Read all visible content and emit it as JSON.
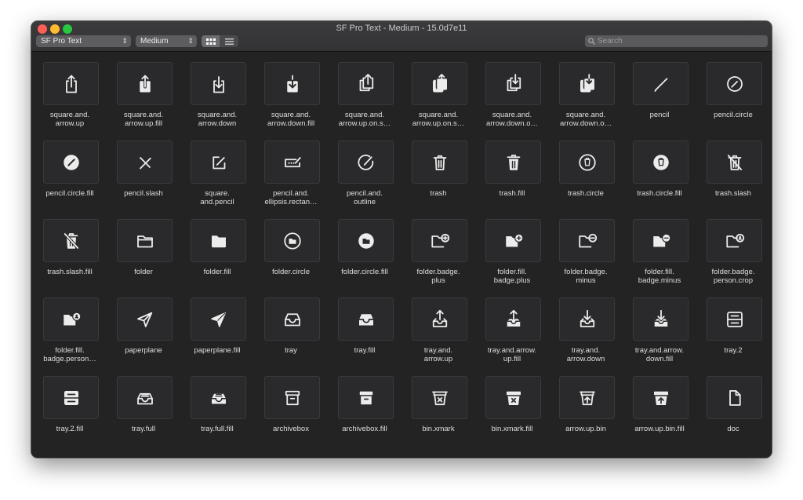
{
  "window": {
    "title": "SF Pro Text - Medium - 15.0d7e11"
  },
  "toolbar": {
    "font": "SF Pro Text",
    "weight": "Medium",
    "search_placeholder": "Search",
    "view_mode": "grid"
  },
  "symbols": [
    {
      "name": "square.and.\narrow.up",
      "icon": "share-icon"
    },
    {
      "name": "square.and.\narrow.up.fill",
      "icon": "share-fill-icon"
    },
    {
      "name": "square.and.\narrow.down",
      "icon": "download-icon"
    },
    {
      "name": "square.and.\narrow.down.fill",
      "icon": "download-fill-icon"
    },
    {
      "name": "square.and.\narrow.up.on.s…",
      "icon": "share-stack-icon"
    },
    {
      "name": "square.and.\narrow.up.on.s…",
      "icon": "share-stack-fill-icon"
    },
    {
      "name": "square.and.\narrow.down.o…",
      "icon": "download-stack-icon"
    },
    {
      "name": "square.and.\narrow.down.o…",
      "icon": "download-stack-fill-icon"
    },
    {
      "name": "pencil",
      "icon": "pencil-icon"
    },
    {
      "name": "pencil.circle",
      "icon": "pencil-circle-icon"
    },
    {
      "name": "pencil.circle.fill",
      "icon": "pencil-circle-fill-icon"
    },
    {
      "name": "pencil.slash",
      "icon": "pencil-slash-icon"
    },
    {
      "name": "square.\nand.pencil",
      "icon": "square-pencil-icon"
    },
    {
      "name": "pencil.and.\nellipsis.rectan…",
      "icon": "pencil-ellipsis-rect-icon"
    },
    {
      "name": "pencil.and.\noutline",
      "icon": "pencil-outline-icon"
    },
    {
      "name": "trash",
      "icon": "trash-icon"
    },
    {
      "name": "trash.fill",
      "icon": "trash-fill-icon"
    },
    {
      "name": "trash.circle",
      "icon": "trash-circle-icon"
    },
    {
      "name": "trash.circle.fill",
      "icon": "trash-circle-fill-icon"
    },
    {
      "name": "trash.slash",
      "icon": "trash-slash-icon"
    },
    {
      "name": "trash.slash.fill",
      "icon": "trash-slash-fill-icon"
    },
    {
      "name": "folder",
      "icon": "folder-icon"
    },
    {
      "name": "folder.fill",
      "icon": "folder-fill-icon"
    },
    {
      "name": "folder.circle",
      "icon": "folder-circle-icon"
    },
    {
      "name": "folder.circle.fill",
      "icon": "folder-circle-fill-icon"
    },
    {
      "name": "folder.badge.\nplus",
      "icon": "folder-plus-icon"
    },
    {
      "name": "folder.fill.\nbadge.plus",
      "icon": "folder-fill-plus-icon"
    },
    {
      "name": "folder.badge.\nminus",
      "icon": "folder-minus-icon"
    },
    {
      "name": "folder.fill.\nbadge.minus",
      "icon": "folder-fill-minus-icon"
    },
    {
      "name": "folder.badge.\nperson.crop",
      "icon": "folder-person-icon"
    },
    {
      "name": "folder.fill.\nbadge.person…",
      "icon": "folder-fill-person-icon"
    },
    {
      "name": "paperplane",
      "icon": "paperplane-icon"
    },
    {
      "name": "paperplane.fill",
      "icon": "paperplane-fill-icon"
    },
    {
      "name": "tray",
      "icon": "tray-icon"
    },
    {
      "name": "tray.fill",
      "icon": "tray-fill-icon"
    },
    {
      "name": "tray.and.\narrow.up",
      "icon": "tray-arrow-up-icon"
    },
    {
      "name": "tray.and.arrow.\nup.fill",
      "icon": "tray-arrow-up-fill-icon"
    },
    {
      "name": "tray.and.\narrow.down",
      "icon": "tray-arrow-down-icon"
    },
    {
      "name": "tray.and.arrow.\ndown.fill",
      "icon": "tray-arrow-down-fill-icon"
    },
    {
      "name": "tray.2",
      "icon": "tray-2-icon"
    },
    {
      "name": "tray.2.fill",
      "icon": "tray-2-fill-icon"
    },
    {
      "name": "tray.full",
      "icon": "tray-full-icon"
    },
    {
      "name": "tray.full.fill",
      "icon": "tray-full-fill-icon"
    },
    {
      "name": "archivebox",
      "icon": "archivebox-icon"
    },
    {
      "name": "archivebox.fill",
      "icon": "archivebox-fill-icon"
    },
    {
      "name": "bin.xmark",
      "icon": "bin-xmark-icon"
    },
    {
      "name": "bin.xmark.fill",
      "icon": "bin-xmark-fill-icon"
    },
    {
      "name": "arrow.up.bin",
      "icon": "arrow-up-bin-icon"
    },
    {
      "name": "arrow.up.bin.fill",
      "icon": "arrow-up-bin-fill-icon"
    },
    {
      "name": "doc",
      "icon": "doc-icon"
    }
  ]
}
